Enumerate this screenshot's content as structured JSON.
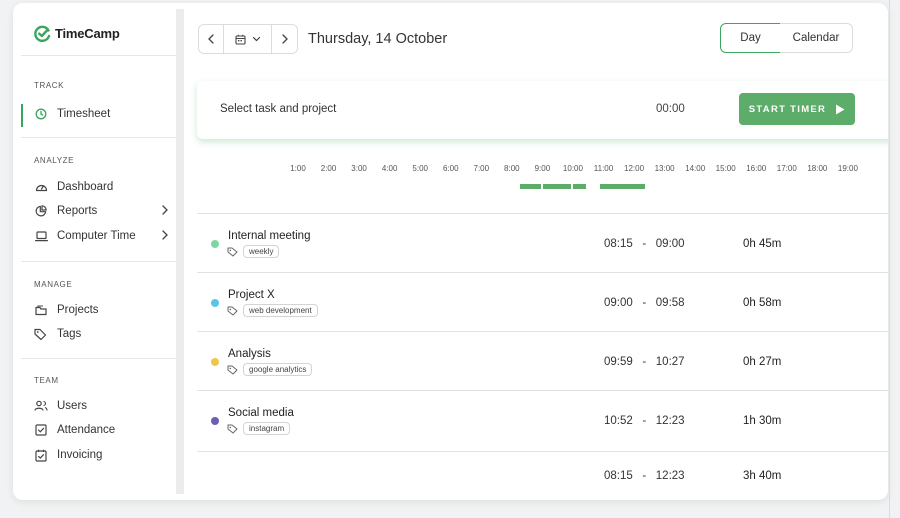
{
  "app": {
    "name": "TimeCamp",
    "brand_color": "#3aa55c"
  },
  "sidebar": {
    "sections": [
      {
        "title": "TRACK",
        "items": [
          {
            "label": "Timesheet",
            "icon": "clock-icon",
            "active": true
          }
        ]
      },
      {
        "title": "ANALYZE",
        "items": [
          {
            "label": "Dashboard",
            "icon": "gauge-icon"
          },
          {
            "label": "Reports",
            "icon": "pie-chart-icon",
            "has_submenu": true
          },
          {
            "label": "Computer Time",
            "icon": "laptop-icon",
            "has_submenu": true
          }
        ]
      },
      {
        "title": "MANAGE",
        "items": [
          {
            "label": "Projects",
            "icon": "folder-icon"
          },
          {
            "label": "Tags",
            "icon": "tags-icon"
          }
        ]
      },
      {
        "title": "TEAM",
        "items": [
          {
            "label": "Users",
            "icon": "users-icon"
          },
          {
            "label": "Attendance",
            "icon": "checkbox-icon"
          },
          {
            "label": "Invoicing",
            "icon": "calendar-check-icon"
          }
        ]
      }
    ]
  },
  "header": {
    "date": "Thursday, 14 October",
    "views": [
      "Day",
      "Calendar"
    ],
    "selected_view": "Day"
  },
  "timer": {
    "task_placeholder": "Select task and project",
    "elapsed": "00:00",
    "start_label": "START TIMER"
  },
  "timeline": {
    "hours": [
      "1:00",
      "2:00",
      "3:00",
      "4:00",
      "5:00",
      "6:00",
      "7:00",
      "8:00",
      "9:00",
      "10:00",
      "11:00",
      "12:00",
      "13:00",
      "14:00",
      "15:00",
      "16:00",
      "17:00",
      "18:00",
      "19:00"
    ]
  },
  "entries": [
    {
      "name": "Internal meeting",
      "tag": "weekly",
      "start": "08:15",
      "end": "09:00",
      "duration": "0h 45m",
      "color": "#7fd6a3"
    },
    {
      "name": "Project X",
      "tag": "web development",
      "start": "09:00",
      "end": "09:58",
      "duration": "0h 58m",
      "color": "#5ec3e8"
    },
    {
      "name": "Analysis",
      "tag": "google analytics",
      "start": "09:59",
      "end": "10:27",
      "duration": "0h 27m",
      "color": "#f0c64a"
    },
    {
      "name": "Social media",
      "tag": "instagram",
      "start": "10:52",
      "end": "12:23",
      "duration": "1h 30m",
      "color": "#6a5fb0"
    }
  ],
  "total": {
    "start": "08:15",
    "end": "12:23",
    "duration": "3h 40m"
  }
}
